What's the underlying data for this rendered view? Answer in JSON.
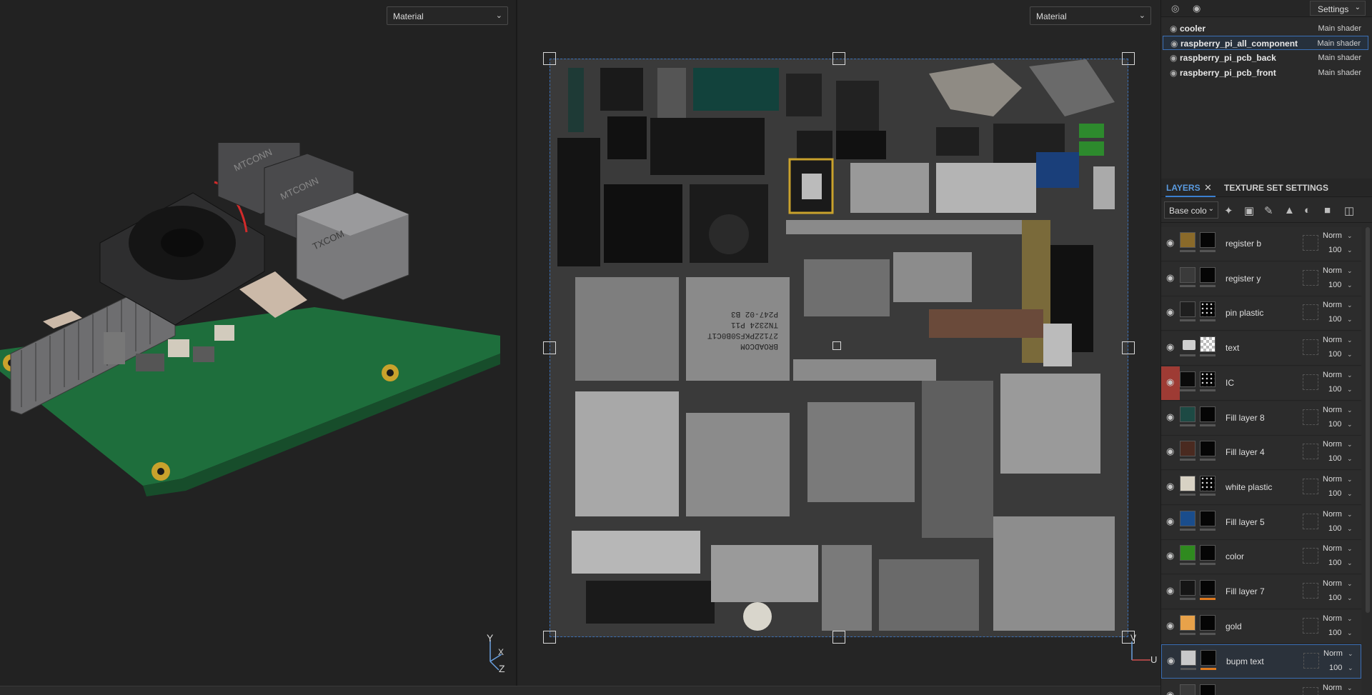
{
  "viewport_3d": {
    "material_dropdown": "Material",
    "axis": {
      "y": "Y",
      "x": "X",
      "z": "Z"
    }
  },
  "viewport_2d": {
    "material_dropdown": "Material",
    "axis": {
      "v": "V",
      "u": "U"
    }
  },
  "texture_sets": [
    {
      "name": "cooler",
      "shader": "Main shader",
      "selected": false
    },
    {
      "name": "raspberry_pi_all_component",
      "shader": "Main shader",
      "selected": true
    },
    {
      "name": "raspberry_pi_pcb_back",
      "shader": "Main shader",
      "selected": false
    },
    {
      "name": "raspberry_pi_pcb_front",
      "shader": "Main shader",
      "selected": false
    }
  ],
  "top_bar": {
    "settings_label": "Settings",
    "icons": [
      "eye-crossed-icon",
      "eye-icon"
    ]
  },
  "panel_tabs": {
    "layers": "LAYERS",
    "texture_set_settings": "TEXTURE SET SETTINGS"
  },
  "channel_select": "Base colo",
  "tools": [
    "add-effect-icon",
    "mask-icon",
    "paint-layer-icon",
    "fill-layer-icon",
    "smart-material-icon",
    "folder-icon",
    "trash-icon"
  ],
  "layers": [
    {
      "name": "register b",
      "color": "#8a6a2a",
      "mask": "dark",
      "blend": "Norm",
      "opacity": "100",
      "bar": "gray",
      "eye_red": false,
      "selected": false
    },
    {
      "name": "register y",
      "color": "#3a3a3a",
      "mask": "dark",
      "blend": "Norm",
      "opacity": "100",
      "bar": "gray",
      "eye_red": false,
      "selected": false
    },
    {
      "name": "pin plastic",
      "color": "#1f1f1f",
      "mask": "speckle",
      "blend": "Norm",
      "opacity": "100",
      "bar": "gray",
      "eye_red": false,
      "selected": false
    },
    {
      "name": "text",
      "color": "folder",
      "mask": "checker",
      "blend": "Norm",
      "opacity": "100",
      "bar": "gray",
      "eye_red": false,
      "selected": false
    },
    {
      "name": "IC",
      "color": "#0a0a0a",
      "mask": "speckle",
      "blend": "Norm",
      "opacity": "100",
      "bar": "gray",
      "eye_red": true,
      "selected": false
    },
    {
      "name": "Fill layer 8",
      "color": "#1d4a44",
      "mask": "dark",
      "blend": "Norm",
      "opacity": "100",
      "bar": "gray",
      "eye_red": false,
      "selected": false
    },
    {
      "name": "Fill layer 4",
      "color": "#4a2a20",
      "mask": "dark",
      "blend": "Norm",
      "opacity": "100",
      "bar": "gray",
      "eye_red": false,
      "selected": false
    },
    {
      "name": "white plastic",
      "color": "#d8d2c4",
      "mask": "speckle",
      "blend": "Norm",
      "opacity": "100",
      "bar": "gray",
      "eye_red": false,
      "selected": false
    },
    {
      "name": "Fill layer 5",
      "color": "#1a4d8c",
      "mask": "dark",
      "blend": "Norm",
      "opacity": "100",
      "bar": "gray",
      "eye_red": false,
      "selected": false
    },
    {
      "name": "color",
      "color": "#2f8a1f",
      "mask": "dark",
      "blend": "Norm",
      "opacity": "100",
      "bar": "gray",
      "eye_red": false,
      "selected": false
    },
    {
      "name": "Fill layer 7",
      "color": "#151515",
      "mask": "dark",
      "blend": "Norm",
      "opacity": "100",
      "bar": "orange",
      "eye_red": false,
      "selected": false
    },
    {
      "name": "gold",
      "color": "#e8a24a",
      "mask": "dark",
      "blend": "Norm",
      "opacity": "100",
      "bar": "gray",
      "eye_red": false,
      "selected": false
    },
    {
      "name": "bupm text",
      "color": "#c9c9c9",
      "mask": "dark",
      "blend": "Norm",
      "opacity": "100",
      "bar": "orange",
      "eye_red": false,
      "selected": true
    },
    {
      "name": "",
      "color": "#3a3a3a",
      "mask": "dark",
      "blend": "Norm",
      "opacity": "",
      "bar": "gray",
      "eye_red": false,
      "selected": false
    }
  ],
  "uv_text": {
    "chip_line1": "BROADCOM",
    "chip_line2": "2712ZPKFS0B0C1T",
    "chip_line3": "TN2324 P11",
    "chip_line4": "P247-02 B3"
  },
  "board_labels": {
    "usb1": "MTCONN",
    "usb2": "MTCONN",
    "eth": "TXCOM"
  },
  "colors": {
    "accent": "#3b7fd0",
    "selection_border": "#3b6fb5",
    "pcb_green": "#1f6b3a"
  }
}
